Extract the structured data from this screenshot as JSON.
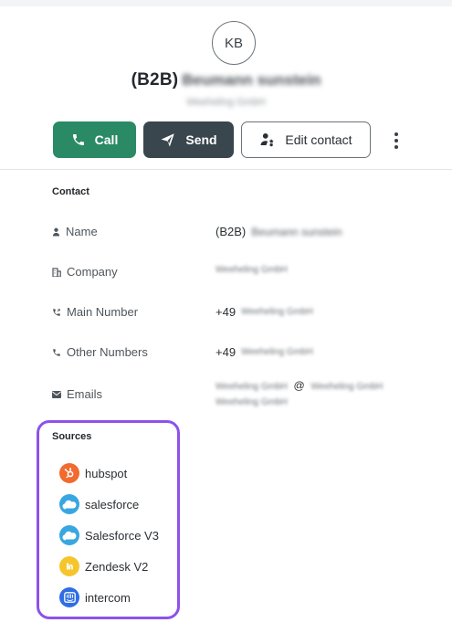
{
  "header": {
    "initials": "KB",
    "name_prefix": "(B2B)",
    "name_redacted": "Beumann sunstein",
    "company_redacted": "Weeheling GmbH"
  },
  "actions": {
    "call_label": "Call",
    "send_label": "Send",
    "edit_label": "Edit contact"
  },
  "contact": {
    "section_title": "Contact",
    "fields": [
      {
        "label": "Name",
        "icon": "person-icon",
        "value_prefix": "(B2B)",
        "value_redacted": "Beumann sunstein"
      },
      {
        "label": "Company",
        "icon": "building-icon",
        "value_redacted": "Weeheling GmbH"
      },
      {
        "label": "Main Number",
        "icon": "phone-forward-icon",
        "value_prefix": "+49",
        "value_redacted": "Weeheling GmbH"
      },
      {
        "label": "Other Numbers",
        "icon": "phone-icon",
        "value_prefix": "+49",
        "value_redacted": "Weeheling GmbH"
      },
      {
        "label": "Emails",
        "icon": "envelope-icon",
        "value_line1_redacted": "Weeheling GmbH",
        "value_at": "@",
        "value_line1b_redacted": "Weeheling GmbH",
        "value_line2_redacted": "Weeheling GmbH"
      }
    ]
  },
  "sources": {
    "section_title": "Sources",
    "highlight_color": "#8c52ec",
    "items": [
      {
        "label": "hubspot",
        "icon": "hubspot-icon",
        "color": "#f26a2e"
      },
      {
        "label": "salesforce",
        "icon": "salesforce-icon",
        "color": "#38a7e0"
      },
      {
        "label": "Salesforce V3",
        "icon": "salesforce-icon",
        "color": "#38a7e0"
      },
      {
        "label": "Zendesk V2",
        "icon": "zendesk-icon",
        "color": "#f5c52c"
      },
      {
        "label": "intercom",
        "icon": "intercom-icon",
        "color": "#2f6de3"
      }
    ]
  }
}
